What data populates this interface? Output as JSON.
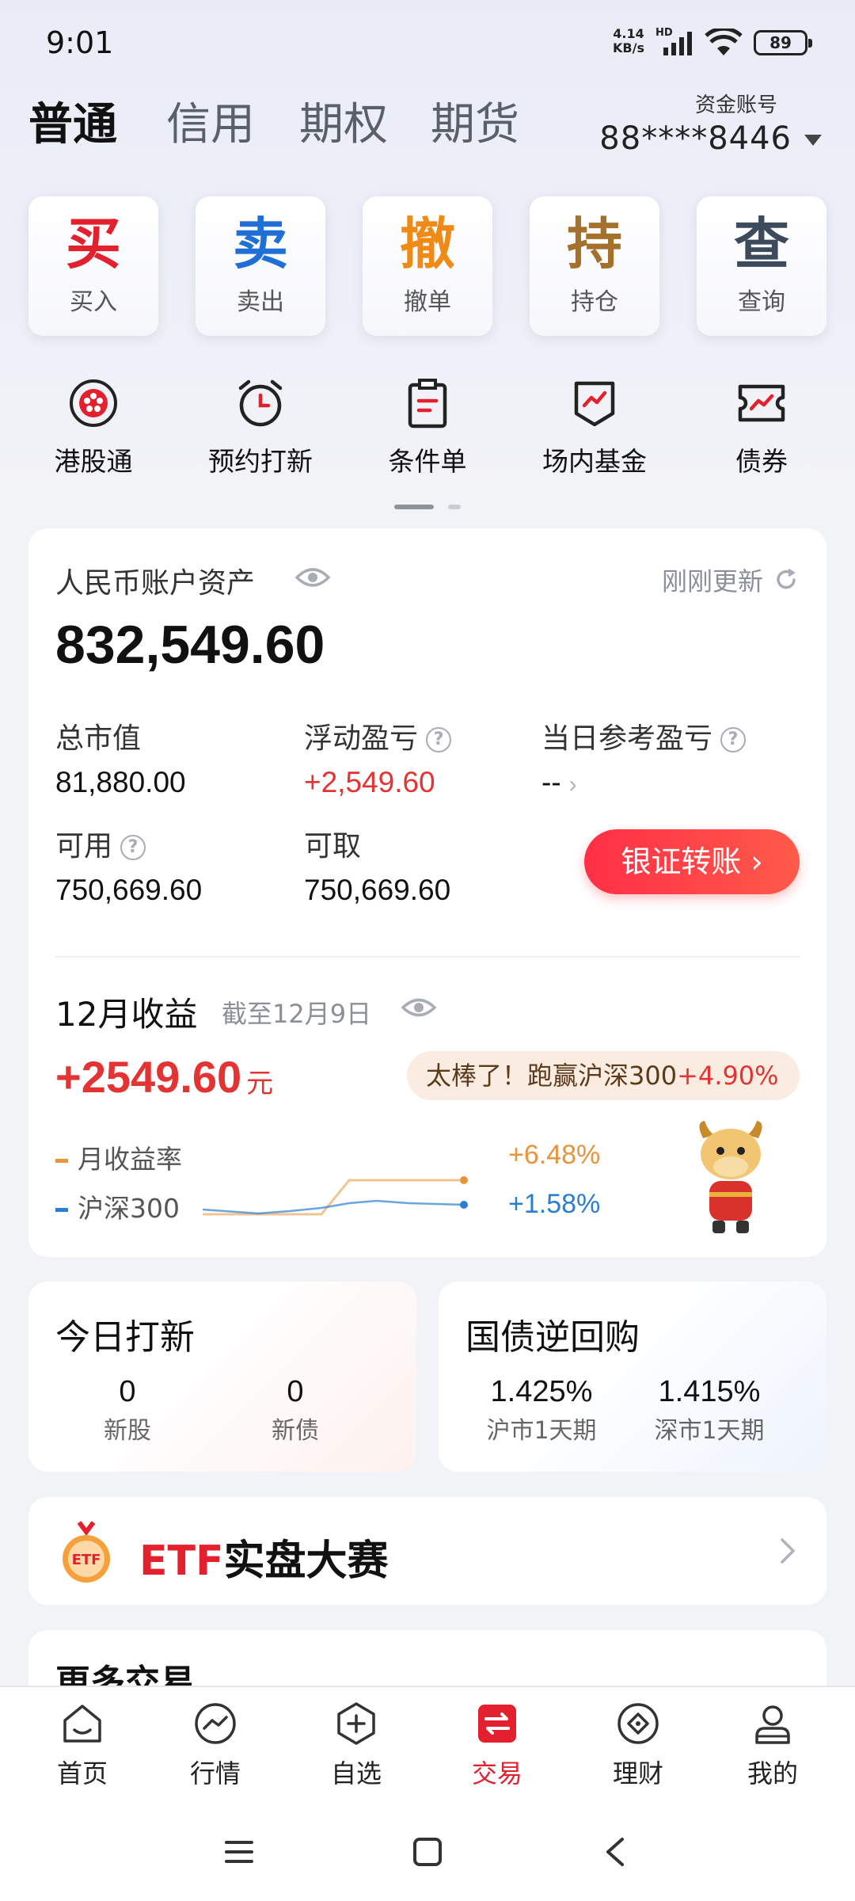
{
  "status": {
    "time": "9:01",
    "net_speed": "4.14",
    "net_unit": "KB/s",
    "hd": "HD",
    "battery": "89"
  },
  "tabs": [
    {
      "label": "普通",
      "active": true
    },
    {
      "label": "信用",
      "active": false
    },
    {
      "label": "期权",
      "active": false
    },
    {
      "label": "期货",
      "active": false
    }
  ],
  "account": {
    "label": "资金账号",
    "number": "88****8446"
  },
  "quick_actions": [
    {
      "big": "买",
      "label": "买入",
      "color": "#e3202e"
    },
    {
      "big": "卖",
      "label": "卖出",
      "color": "#1f6fd6"
    },
    {
      "big": "撤",
      "label": "撤单",
      "color": "#f08a16"
    },
    {
      "big": "持",
      "label": "持仓",
      "color": "#a5702b"
    },
    {
      "big": "查",
      "label": "查询",
      "color": "#3d4a5c"
    }
  ],
  "shortcuts": [
    {
      "label": "港股通",
      "icon": "hk-flower-icon"
    },
    {
      "label": "预约打新",
      "icon": "alarm-clock-icon"
    },
    {
      "label": "条件单",
      "icon": "clipboard-icon"
    },
    {
      "label": "场内基金",
      "icon": "fund-shield-icon"
    },
    {
      "label": "债券",
      "icon": "bond-ticket-icon"
    }
  ],
  "asset": {
    "title": "人民币账户资产",
    "updated": "刚刚更新",
    "total": "832,549.60",
    "market_value_label": "总市值",
    "market_value": "81,880.00",
    "float_pl_label": "浮动盈亏",
    "float_pl": "+2,549.60",
    "today_pl_label": "当日参考盈亏",
    "today_pl": "--",
    "available_label": "可用",
    "available": "750,669.60",
    "withdrawable_label": "可取",
    "withdrawable": "750,669.60",
    "transfer_button": "银证转账 ›"
  },
  "monthly": {
    "title": "12月收益",
    "as_of": "截至12月9日",
    "value": "+2549.60",
    "unit": "元",
    "praise_prefix": "太棒了！跑赢沪深300",
    "praise_value": "+4.90%",
    "legend_return": "月收益率",
    "legend_index": "沪深300",
    "return_pct": "+6.48%",
    "index_pct": "+1.58%",
    "return_color": "#e8943a",
    "index_color": "#2a7fd4"
  },
  "ipo": {
    "title": "今日打新",
    "stocks_count": "0",
    "stocks_label": "新股",
    "bonds_count": "0",
    "bonds_label": "新债"
  },
  "repo": {
    "title": "国债逆回购",
    "sh_rate": "1.425%",
    "sh_label": "沪市1天期",
    "sz_rate": "1.415%",
    "sz_label": "深市1天期"
  },
  "etf": {
    "prefix": "ETF",
    "title": "实盘大赛",
    "medal_text": "ETF"
  },
  "more": {
    "title": "更多交易"
  },
  "tabbar": [
    {
      "label": "首页",
      "icon": "home-icon",
      "active": false
    },
    {
      "label": "行情",
      "icon": "market-icon",
      "active": false
    },
    {
      "label": "自选",
      "icon": "watchlist-icon",
      "active": false
    },
    {
      "label": "交易",
      "icon": "trade-icon",
      "active": true
    },
    {
      "label": "理财",
      "icon": "wealth-icon",
      "active": false
    },
    {
      "label": "我的",
      "icon": "profile-icon",
      "active": false
    }
  ]
}
